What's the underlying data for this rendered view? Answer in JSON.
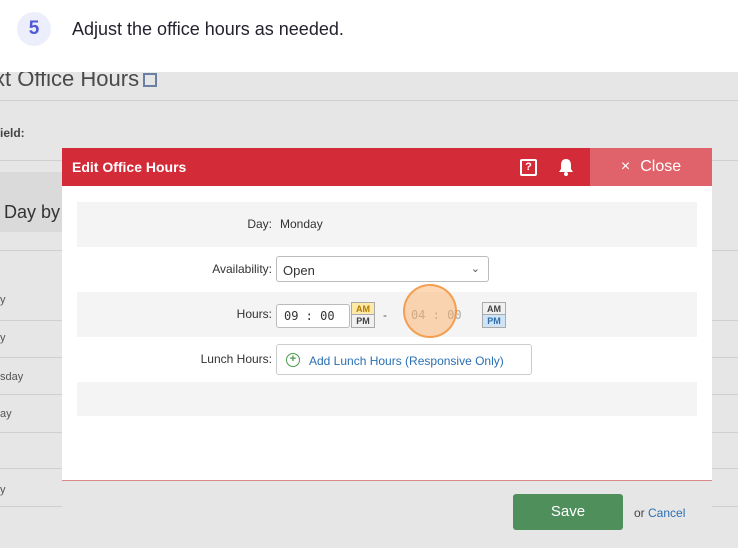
{
  "step": {
    "number": "5",
    "instruction": "Adjust the office hours as needed."
  },
  "background": {
    "title": "xt Office Hours",
    "field_label": "ield:",
    "section_label": "Day by",
    "rows": [
      "y",
      "y",
      "sday",
      "ay",
      "y"
    ]
  },
  "modal": {
    "title": "Edit Office Hours",
    "help_icon": "?",
    "close_label": "Close",
    "close_icon": "×",
    "day": {
      "label": "Day:",
      "value": "Monday"
    },
    "availability": {
      "label": "Availability:",
      "value": "Open",
      "chevron": "⌄"
    },
    "hours": {
      "label": "Hours:",
      "start": {
        "value": "09 : 00",
        "am": "AM",
        "pm": "PM",
        "selected": "AM"
      },
      "separator": "-",
      "end": {
        "value": "04 : 00",
        "am": "AM",
        "pm": "PM",
        "selected": "PM"
      }
    },
    "lunch": {
      "label": "Lunch Hours:",
      "button_label": "Add Lunch Hours (Responsive Only)",
      "icon": "+"
    },
    "footer": {
      "save_label": "Save",
      "or_text": "or",
      "cancel_label": "Cancel"
    }
  },
  "colors": {
    "header_red": "#d42b39",
    "close_red": "#e0636c",
    "save_green": "#4f8f5c",
    "link_blue": "#2a6fb3",
    "badge_blue": "#4d59d6"
  }
}
